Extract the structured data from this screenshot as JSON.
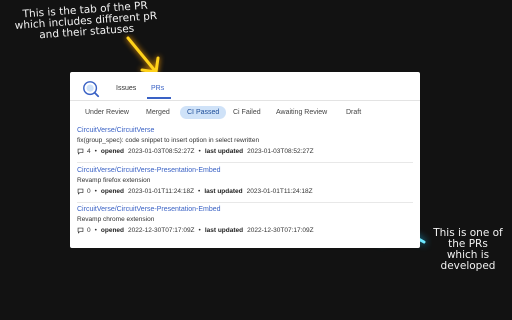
{
  "annotations": {
    "tab_note": "This is the tab of the PR\nwhich includes different  pR\nand their statuses",
    "pr_note": "This is one of\nthe PRs\nwhich is\ndeveloped"
  },
  "tabs": [
    {
      "label": "Issues"
    },
    {
      "label": "PRs"
    }
  ],
  "filters": [
    {
      "label": "Under Review"
    },
    {
      "label": "Merged"
    },
    {
      "label": "CI Passed"
    },
    {
      "label": "Ci Failed"
    },
    {
      "label": "Awaiting Review"
    },
    {
      "label": "Draft"
    }
  ],
  "pull_requests": [
    {
      "repo": "CircuitVerse/CircuitVerse",
      "title": "fix(group_spec): code snippet to insert option in select rewritten",
      "comments": "4",
      "opened_label": "opened",
      "opened": "2023-01-03T08:52:27Z",
      "updated_label": "last updated",
      "updated": "2023-01-03T08:52:27Z"
    },
    {
      "repo": "CircuitVerse/CircuitVerse-Presentation-Embed",
      "title": "Revamp firefox extension",
      "comments": "0",
      "opened_label": "opened",
      "opened": "2023-01-01T11:24:18Z",
      "updated_label": "last updated",
      "updated": "2023-01-01T11:24:18Z"
    },
    {
      "repo": "CircuitVerse/CircuitVerse-Presentation-Embed",
      "title": "Revamp chrome extension",
      "comments": "0",
      "opened_label": "opened",
      "opened": "2022-12-30T07:17:09Z",
      "updated_label": "last updated",
      "updated": "2022-12-30T07:17:09Z"
    }
  ],
  "colors": {
    "accent": "#3a62c5",
    "active_filter_bg": "#cfe2f8",
    "arrow_yellow": "#ffd21a",
    "arrow_cyan": "#6ee8ff"
  }
}
